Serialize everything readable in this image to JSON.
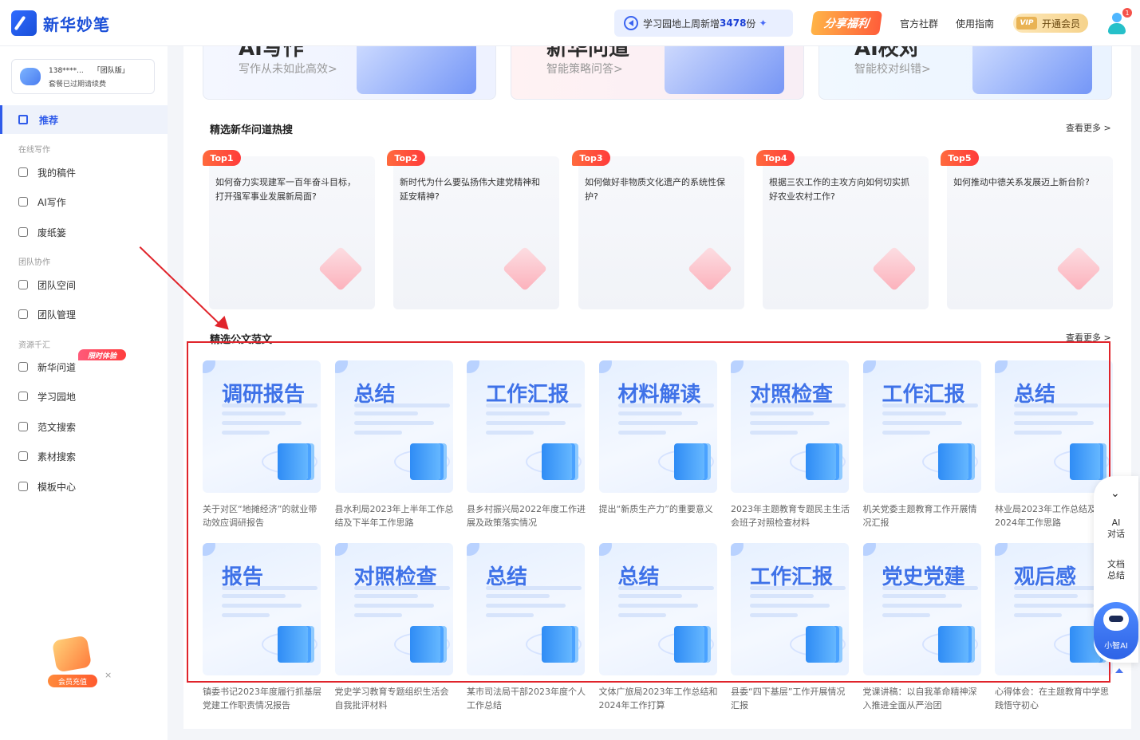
{
  "header": {
    "app_name": "新华妙笔",
    "notice_prefix": "学习园地上周新增",
    "notice_count": "3478",
    "notice_suffix": "份",
    "share_badge": "分享福利",
    "links": [
      "官方社群",
      "使用指南"
    ],
    "vip_tag": "VIP",
    "vip_label": "开通会员",
    "notification_count": "1"
  },
  "sidebar": {
    "account": {
      "phone": "138****...",
      "edition": "「团队版」",
      "status": "套餐已过期请续费"
    },
    "active_item": "推荐",
    "groups": [
      {
        "title": "在线写作",
        "items": [
          "我的稿件",
          "AI写作",
          "废纸篓"
        ]
      },
      {
        "title": "团队协作",
        "items": [
          "团队空间",
          "团队管理"
        ]
      },
      {
        "title": "资源千汇",
        "items": [
          "新华问道",
          "学习园地",
          "范文搜索",
          "素材搜索",
          "模板中心"
        ]
      }
    ],
    "limit_tag": "限时体验",
    "promo_label": "会员充值",
    "promo_close": "×"
  },
  "features": [
    {
      "big": "AI写作",
      "desc": "写作从未如此高效>"
    },
    {
      "big": "新华问道",
      "desc": "智能策略问答>"
    },
    {
      "big": "AI校对",
      "desc": "智能校对纠错>"
    }
  ],
  "hot_section": {
    "title": "精选新华问道热搜",
    "more": "查看更多 >",
    "items": [
      {
        "rank": "Top1",
        "question": "如何奋力实现建军一百年奋斗目标，打开强军事业发展新局面?"
      },
      {
        "rank": "Top2",
        "question": "新时代为什么要弘扬伟大建党精神和延安精神?"
      },
      {
        "rank": "Top3",
        "question": "如何做好非物质文化遗产的系统性保护?"
      },
      {
        "rank": "Top4",
        "question": "根据三农工作的主攻方向如何切实抓好农业农村工作?"
      },
      {
        "rank": "Top5",
        "question": "如何推动中德关系发展迈上新台阶?"
      }
    ]
  },
  "doc_section": {
    "title": "精选公文范文",
    "more": "查看更多 >",
    "row1": [
      {
        "category": "调研报告",
        "title": "关于对区“地摊经济”的就业带动效应调研报告"
      },
      {
        "category": "总结",
        "title": "县水利局2023年上半年工作总结及下半年工作思路"
      },
      {
        "category": "工作汇报",
        "title": "县乡村振兴局2022年度工作进展及政策落实情况"
      },
      {
        "category": "材料解读",
        "title": "提出“新质生产力”的重要意义"
      },
      {
        "category": "对照检查",
        "title": "2023年主题教育专题民主生活会班子对照检查材料"
      },
      {
        "category": "工作汇报",
        "title": "机关党委主题教育工作开展情况汇报"
      },
      {
        "category": "总结",
        "title": "林业局2023年工作总结及2024年工作思路"
      }
    ],
    "row2": [
      {
        "category": "报告",
        "title": "镇委书记2023年度履行抓基层党建工作职责情况报告"
      },
      {
        "category": "对照检查",
        "title": "党史学习教育专题组织生活会自我批评材料"
      },
      {
        "category": "总结",
        "title": "某市司法局干部2023年度个人工作总结"
      },
      {
        "category": "总结",
        "title": "文体广旅局2023年工作总结和2024年工作打算"
      },
      {
        "category": "工作汇报",
        "title": "县委“四下基层”工作开展情况汇报"
      },
      {
        "category": "党史党建",
        "title": "党课讲稿：以自我革命精神深入推进全面从严治团"
      },
      {
        "category": "观后感",
        "title": "心得体会：在主题教育中学思践悟守初心"
      }
    ]
  },
  "float_panel": {
    "chevron": "⌄",
    "items": [
      [
        "AI",
        "对话"
      ],
      [
        "文档",
        "总结"
      ]
    ],
    "bot_label": "小智AI"
  },
  "annotation_color": "#e0242b",
  "accent": "#2f5bea"
}
